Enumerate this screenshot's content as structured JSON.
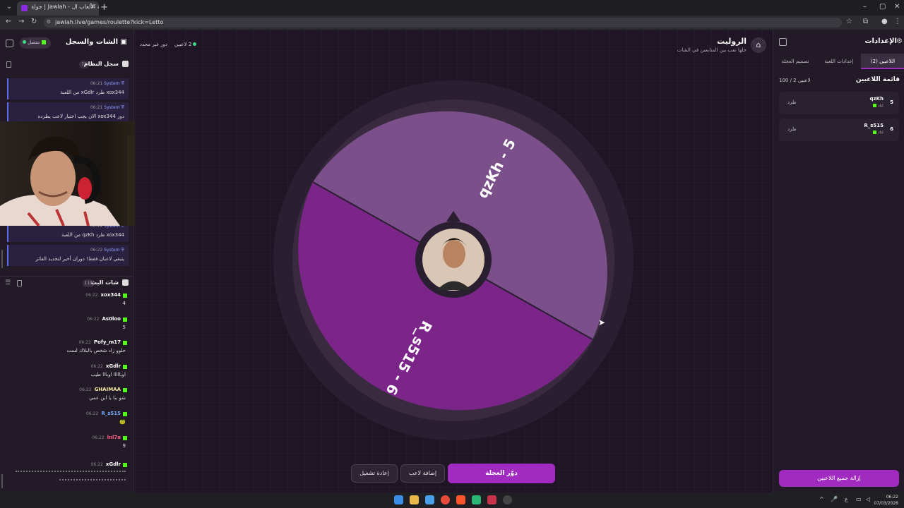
{
  "browser": {
    "tab_title": "جولة | Jawlah - منصة الألعاب ال",
    "url": "jawlah.live/games/roulette?kick=Letto"
  },
  "left_panel": {
    "title": "الشات والسجل",
    "status": "متصل",
    "system_log": {
      "title": "سجل النظام",
      "count": "73",
      "messages": [
        {
          "sender": "System",
          "time": "06:21",
          "text": "xox344 طرد xGdlr من اللعبة"
        },
        {
          "sender": "System",
          "time": "06:21",
          "text": "دور xox344 الان يجب اختيار لاعب يطرده"
        },
        {
          "sender": "System",
          "time": "06:22",
          "text": "xox344 طرد qzKh من اللعبة"
        },
        {
          "sender": "System",
          "time": "06:22",
          "text": "يتبقى لاعبان فقط! دوران أخير لتحديد الفائز"
        }
      ]
    },
    "live_chat": {
      "title": "شات البث",
      "count": "110",
      "messages": [
        {
          "user": "xox344",
          "time": "06:22",
          "text": "4",
          "color": "#ffffff"
        },
        {
          "user": "As0loo",
          "time": "06:22",
          "text": "5",
          "color": "#ffffff"
        },
        {
          "user": "Pofy_m17",
          "time": "06:22",
          "text": "حلوو زاد شخص بالبلاك لست",
          "color": "#ffffff"
        },
        {
          "user": "xGdlr",
          "time": "06:22",
          "text": "اوبااااا اوبااا طيب",
          "color": "#ffffff"
        },
        {
          "user": "GHAIMAA",
          "time": "06:22",
          "text": "شو بنا يا ابن عمي",
          "color": "#f5e6a0"
        },
        {
          "user": "R_s515",
          "time": "06:22",
          "text": "🐸",
          "color": "#6fa8ff"
        },
        {
          "user": "lnl7a",
          "time": "06:22",
          "text": "9",
          "color": "#ff5a8a"
        },
        {
          "user": "xGdlr",
          "time": "06:22",
          "text": "",
          "color": "#ffffff"
        }
      ]
    }
  },
  "main": {
    "title": "الروليت",
    "subtitle": "خلها تقب بين المتابعين في الشات",
    "players_count": "2 لاعبين",
    "turn_label": "دور غير محدد",
    "wheel": {
      "segments": [
        {
          "label": "qzKh - 5",
          "color": "#7a4f8a"
        },
        {
          "label": "R_s515 - 6",
          "color": "#7b2589"
        }
      ]
    },
    "buttons": {
      "restart": "إعادة تشغيل",
      "add_player": "إضافة لاعب",
      "spin": "دوّر العجلة"
    }
  },
  "right_panel": {
    "title": "الإعدادات",
    "tabs": [
      "اللاعبين (2)",
      "إعدادات اللعبة",
      "تصميم العجلة"
    ],
    "list_title": "قائمة اللاعبين",
    "list_count": "100 / 2 لاعبين",
    "players": [
      {
        "number": "5",
        "name": "qzKh",
        "platform": "كيك",
        "kick_label": "طرد"
      },
      {
        "number": "6",
        "name": "R_s515",
        "platform": "كيك",
        "kick_label": "طرد"
      }
    ],
    "remove_all": "إزالة جميع اللاعبين"
  },
  "taskbar": {
    "time": "06:22",
    "date": "07/03/2026",
    "lang": "ع"
  }
}
